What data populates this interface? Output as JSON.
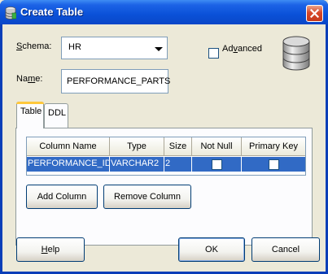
{
  "window": {
    "title": "Create Table",
    "close_icon": "close-icon",
    "title_icon": "database-icon"
  },
  "form": {
    "schema_label_u": "S",
    "schema_label_rest": "chema:",
    "schema_value": "HR",
    "name_label_pre": "Na",
    "name_label_u": "m",
    "name_label_rest": "e:",
    "name_value": "PERFORMANCE_PARTS",
    "advanced_label_pre": "Ad",
    "advanced_label_u": "v",
    "advanced_label_rest": "anced",
    "advanced_checked": false
  },
  "tabs": [
    {
      "label": "Table",
      "active": true
    },
    {
      "label": "DDL",
      "active": false
    }
  ],
  "columns_table": {
    "headers": [
      "Column Name",
      "Type",
      "Size",
      "Not Null",
      "Primary Key"
    ],
    "rows": [
      {
        "column_name": "PERFORMANCE_ID",
        "type": "VARCHAR2",
        "size": "2",
        "not_null": false,
        "primary_key": false
      }
    ]
  },
  "panel_buttons": {
    "add_column": "Add Column",
    "remove_column": "Remove Column"
  },
  "footer": {
    "help_u": "H",
    "help_rest": "elp",
    "ok": "OK",
    "cancel": "Cancel"
  },
  "colors": {
    "title_bar": "#0A51D8",
    "selection": "#316AC5",
    "dialog_bg": "#ECE9D8"
  }
}
